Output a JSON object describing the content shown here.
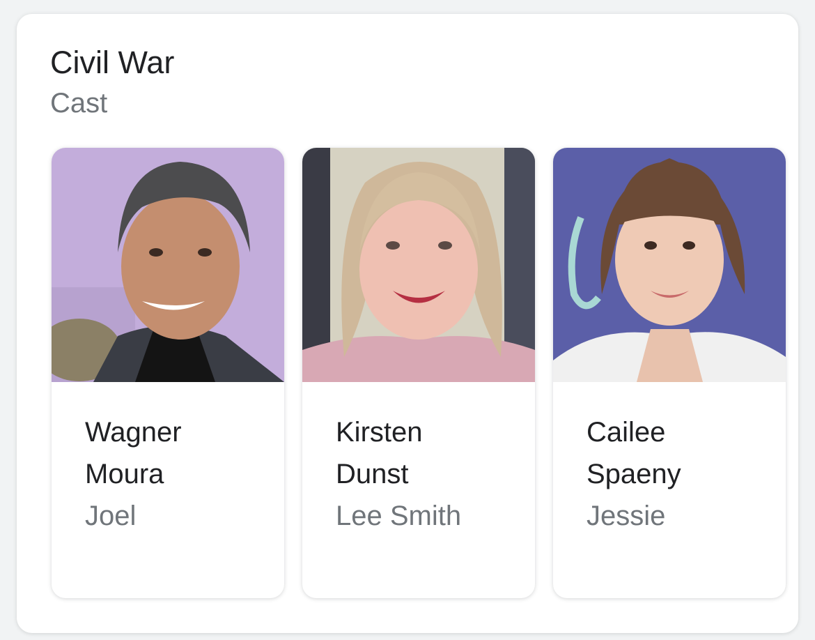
{
  "header": {
    "title": "Civil War",
    "subtitle": "Cast"
  },
  "cast": [
    {
      "name_line1": "Wagner",
      "name_line2": "Moura",
      "role": "Joel"
    },
    {
      "name_line1": "Kirsten",
      "name_line2": "Dunst",
      "role": "Lee Smith"
    },
    {
      "name_line1": "Cailee",
      "name_line2": "Spaeny",
      "role": "Jessie"
    }
  ],
  "colors": {
    "page_background": "#f1f3f4",
    "card_background": "#ffffff",
    "title_text": "#202124",
    "secondary_text": "#70757a"
  }
}
